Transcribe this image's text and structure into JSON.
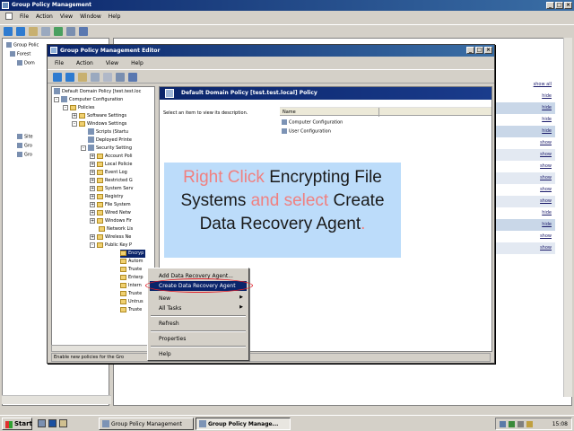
{
  "outer": {
    "title": "Group Policy Management",
    "menu": [
      "File",
      "Action",
      "View",
      "Window",
      "Help"
    ],
    "tree_fragments": [
      "Group Polic",
      "Forest",
      "Dom",
      "Site",
      "Gro",
      "Gro"
    ],
    "right_rows": [
      {
        "label": "show all",
        "bg": "#ffffff"
      },
      {
        "label": "hide",
        "bg": "#ffffff"
      },
      {
        "label": "hide",
        "bg": "#c9d7e8"
      },
      {
        "label": "hide",
        "bg": "#ffffff"
      },
      {
        "label": "hide",
        "bg": "#c9d7e8"
      },
      {
        "label": "show",
        "bg": "#ffffff"
      },
      {
        "label": "show",
        "bg": "#e3e9f2"
      },
      {
        "label": "show",
        "bg": "#ffffff"
      },
      {
        "label": "show",
        "bg": "#e3e9f2"
      },
      {
        "label": "show",
        "bg": "#ffffff"
      },
      {
        "label": "show",
        "bg": "#e3e9f2"
      },
      {
        "label": "hide",
        "bg": "#ffffff"
      },
      {
        "label": "hide",
        "bg": "#c9d7e8"
      },
      {
        "label": "show",
        "bg": "#ffffff"
      },
      {
        "label": "show",
        "bg": "#e3e9f2"
      }
    ]
  },
  "editor": {
    "title": "Group Policy Management Editor",
    "menu": [
      "File",
      "Action",
      "View",
      "Help"
    ],
    "tree": [
      {
        "label": "Default Domain Policy [test.test.loc",
        "pm": "",
        "icon": "policy"
      },
      {
        "label": "Computer Configuration",
        "pm": "-",
        "icon": "policy"
      },
      {
        "label": "Policies",
        "pm": "-",
        "icon": "folder"
      },
      {
        "label": "Software Settings",
        "pm": "+",
        "icon": "folder"
      },
      {
        "label": "Windows Settings",
        "pm": "-",
        "icon": "folder"
      },
      {
        "label": "Scripts (Startu",
        "pm": "",
        "icon": "policy"
      },
      {
        "label": "Deployed Printe",
        "pm": "",
        "icon": "policy"
      },
      {
        "label": "Security Setting",
        "pm": "-",
        "icon": "policy"
      },
      {
        "label": "Account Poli",
        "pm": "+",
        "icon": "folder"
      },
      {
        "label": "Local Policie",
        "pm": "+",
        "icon": "folder"
      },
      {
        "label": "Event Log",
        "pm": "+",
        "icon": "folder"
      },
      {
        "label": "Restricted G",
        "pm": "+",
        "icon": "folder"
      },
      {
        "label": "System Serv",
        "pm": "+",
        "icon": "folder"
      },
      {
        "label": "Registry",
        "pm": "+",
        "icon": "folder"
      },
      {
        "label": "File System",
        "pm": "+",
        "icon": "folder"
      },
      {
        "label": "Wired Netw",
        "pm": "+",
        "icon": "folder"
      },
      {
        "label": "Windows Fir",
        "pm": "+",
        "icon": "folder"
      },
      {
        "label": "Network Lis",
        "pm": "",
        "icon": "folder"
      },
      {
        "label": "Wireless Ne",
        "pm": "+",
        "icon": "folder"
      },
      {
        "label": "Public Key P",
        "pm": "-",
        "icon": "folder"
      },
      {
        "label": "Encryp",
        "pm": "",
        "icon": "folder",
        "selected": true
      },
      {
        "label": "Autom",
        "pm": "",
        "icon": "folder"
      },
      {
        "label": "Truste",
        "pm": "",
        "icon": "folder"
      },
      {
        "label": "Enterp",
        "pm": "",
        "icon": "folder"
      },
      {
        "label": "Intern",
        "pm": "",
        "icon": "folder"
      },
      {
        "label": "Truste",
        "pm": "",
        "icon": "folder"
      },
      {
        "label": "Untrus",
        "pm": "",
        "icon": "folder"
      },
      {
        "label": "Truste",
        "pm": "",
        "icon": "folder"
      }
    ],
    "status": "Enable new policies for the Gro",
    "right": {
      "header": "Default Domain Policy [test.test.local] Policy",
      "hint": "Select an item to view its description.",
      "column_name": "Name",
      "items": [
        "Computer Configuration",
        "User Configuration"
      ]
    }
  },
  "callout": {
    "parts": [
      {
        "text": "Right Click ",
        "highlight": true
      },
      {
        "text": "Encrypting File Systems ",
        "highlight": false
      },
      {
        "text": "and select ",
        "highlight": true
      },
      {
        "text": "Create Data Recovery Agent",
        "highlight": false
      },
      {
        "text": ".",
        "highlight": true
      }
    ]
  },
  "context_menu": {
    "items": [
      {
        "label": "Add Data Recovery Agent...",
        "active": false,
        "submenu": false
      },
      {
        "label": "Create Data Recovery Agent",
        "active": true,
        "submenu": false
      },
      {
        "label": "New",
        "active": false,
        "submenu": true
      },
      {
        "label": "All Tasks",
        "active": false,
        "submenu": true
      },
      {
        "label": "Refresh",
        "active": false,
        "submenu": false
      },
      {
        "label": "Properties",
        "active": false,
        "submenu": false
      },
      {
        "label": "Help",
        "active": false,
        "submenu": false
      }
    ]
  },
  "taskbar": {
    "start": "Start",
    "tasks": [
      {
        "label": "Group Policy Management",
        "active": false
      },
      {
        "label": "Group Policy Manage...",
        "active": true
      }
    ],
    "clock": "15:08"
  },
  "colors": {
    "title_bar": "#0a246a",
    "callout_bg": "#bcdcfa",
    "highlight_text": "#f08080",
    "ring": "#e0202a"
  }
}
